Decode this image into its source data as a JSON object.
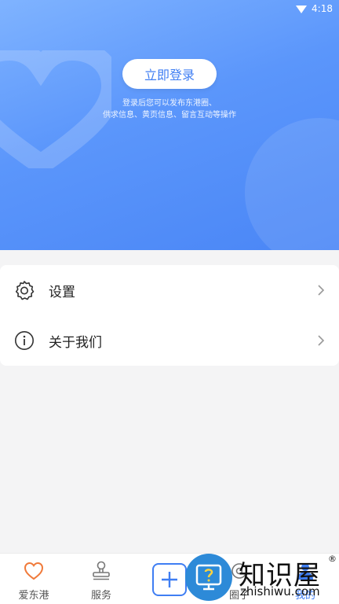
{
  "status_bar": {
    "time": "4:18"
  },
  "header": {
    "login_button": "立即登录",
    "hint_line1": "登录后您可以发布东港圈、",
    "hint_line2": "供求信息、黄页信息、留言互动等操作"
  },
  "menu": [
    {
      "label": "设置",
      "icon": "gear-icon"
    },
    {
      "label": "关于我们",
      "icon": "info-icon"
    }
  ],
  "tabbar": {
    "items": [
      {
        "label": "爱东港",
        "icon": "heart-icon"
      },
      {
        "label": "服务",
        "icon": "stamp-icon"
      },
      {
        "label": "",
        "icon": "plus-icon"
      },
      {
        "label": "圈子",
        "icon": "circle-icon"
      },
      {
        "label": "我的",
        "icon": "user-icon"
      }
    ]
  },
  "watermark": {
    "cn": "知识屋",
    "en": "zhishiwu.com",
    "reg": "®"
  },
  "colors": {
    "accent": "#3f7ef3",
    "header_start": "#7fb3ff",
    "header_end": "#4a86f6"
  }
}
